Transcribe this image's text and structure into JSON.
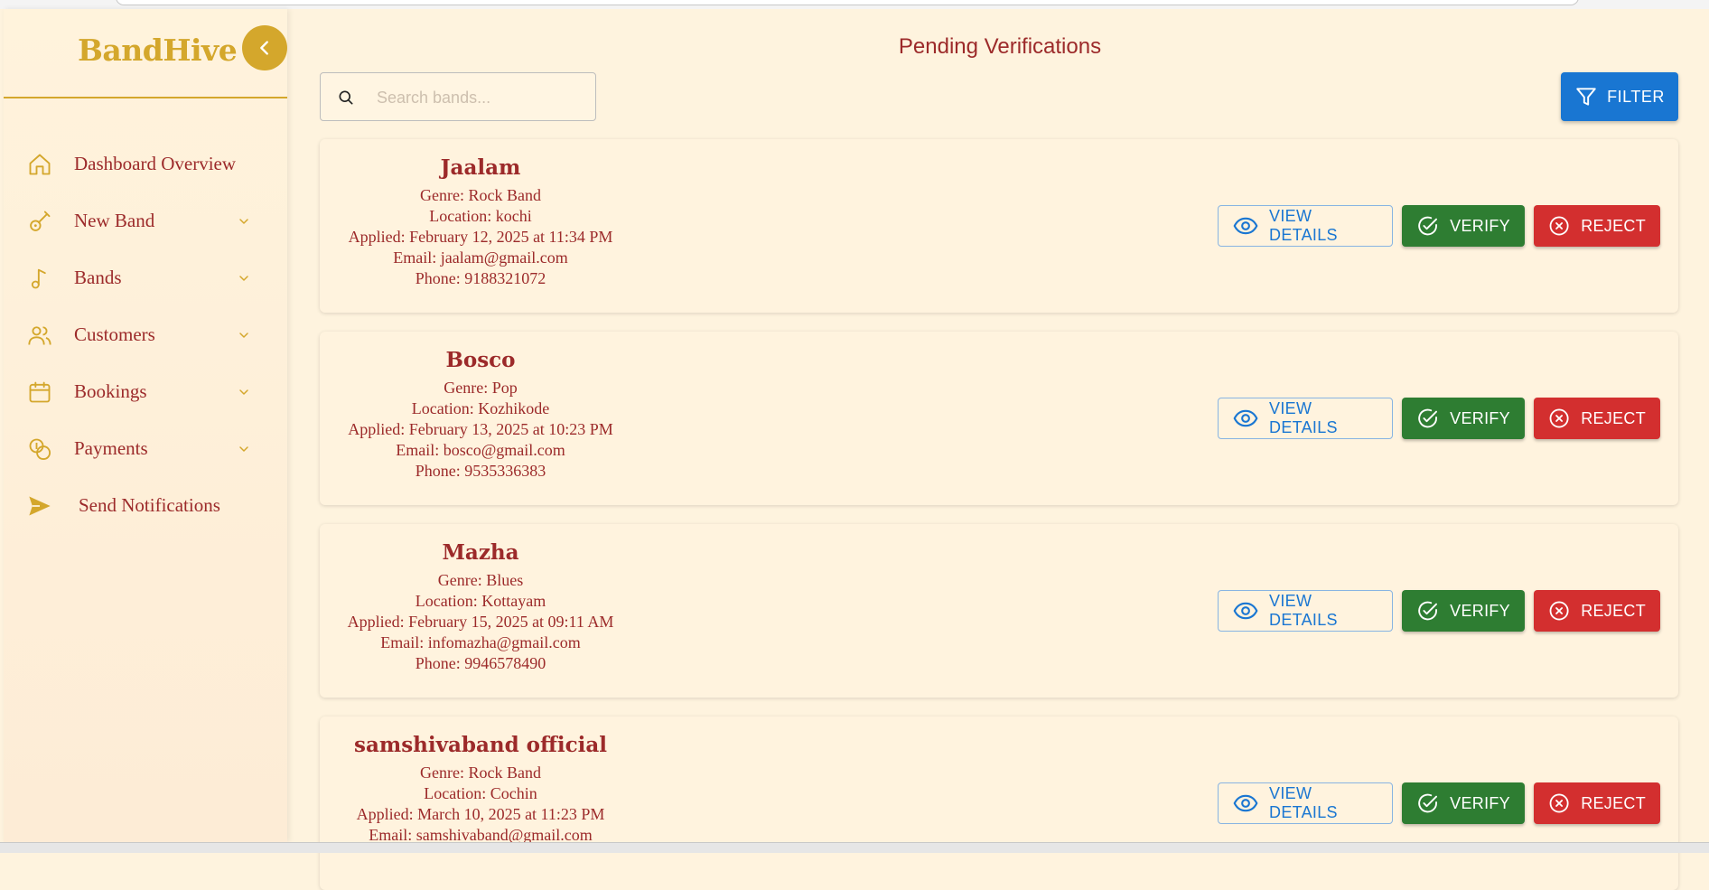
{
  "app": {
    "brand": "BandHive"
  },
  "sidebar": {
    "items": [
      {
        "label": "Dashboard Overview",
        "icon": "home-icon",
        "expandable": false
      },
      {
        "label": "New Band",
        "icon": "guitar-icon",
        "expandable": true
      },
      {
        "label": "Bands",
        "icon": "music-note-icon",
        "expandable": true
      },
      {
        "label": "Customers",
        "icon": "users-icon",
        "expandable": true
      },
      {
        "label": "Bookings",
        "icon": "calendar-icon",
        "expandable": true
      },
      {
        "label": "Payments",
        "icon": "coins-icon",
        "expandable": true
      },
      {
        "label": "Send Notifications",
        "icon": "send-icon",
        "expandable": false
      }
    ]
  },
  "main": {
    "title": "Pending Verifications",
    "search": {
      "placeholder": "Search bands...",
      "value": ""
    },
    "filter_label": "FILTER",
    "actions": {
      "view": "VIEW DETAILS",
      "verify": "VERIFY",
      "reject": "REJECT"
    },
    "bands": [
      {
        "name": "Jaalam",
        "genre": "Genre: Rock Band",
        "location": "Location: kochi",
        "applied": "Applied: February 12, 2025 at 11:34 PM",
        "email": "Email: jaalam@gmail.com",
        "phone": "Phone: 9188321072"
      },
      {
        "name": "Bosco",
        "genre": "Genre: Pop",
        "location": "Location: Kozhikode",
        "applied": "Applied: February 13, 2025 at 10:23 PM",
        "email": "Email: bosco@gmail.com",
        "phone": "Phone: 9535336383"
      },
      {
        "name": "Mazha",
        "genre": "Genre: Blues",
        "location": "Location: Kottayam",
        "applied": "Applied: February 15, 2025 at 09:11 AM",
        "email": "Email: infomazha@gmail.com",
        "phone": "Phone: 9946578490"
      },
      {
        "name": "samshivaband official",
        "genre": "Genre: Rock Band",
        "location": "Location: Cochin",
        "applied": "Applied: March 10, 2025 at 11:23 PM",
        "email": "Email: samshivaband@gmail.com",
        "phone": ""
      }
    ]
  },
  "colors": {
    "background": "#fef3de",
    "brand_gold": "#d4a72c",
    "text_maroon": "#9c2a2a",
    "primary_blue": "#1976d2",
    "verify_green": "#2e7d32",
    "reject_red": "#d32f2f"
  }
}
